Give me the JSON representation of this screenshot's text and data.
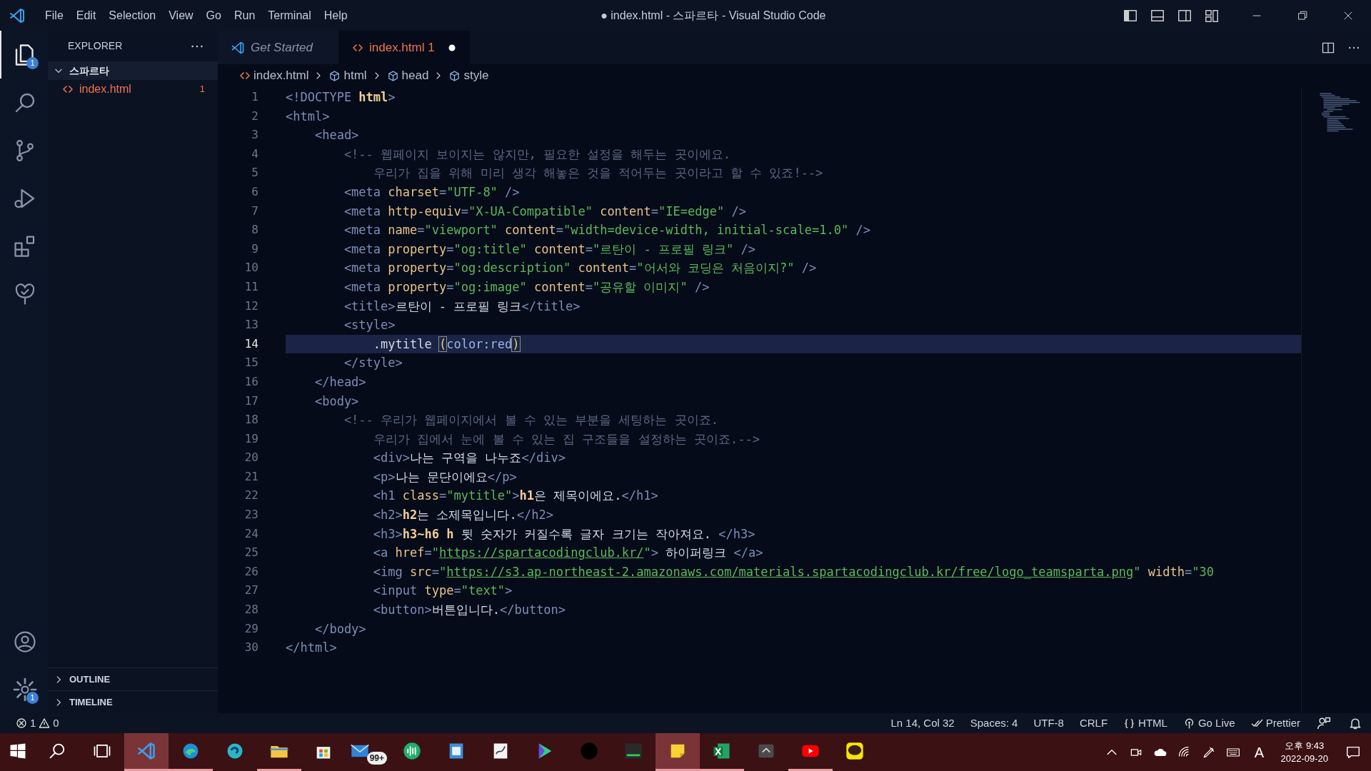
{
  "title_bar": {
    "menu": [
      "File",
      "Edit",
      "Selection",
      "View",
      "Go",
      "Run",
      "Terminal",
      "Help"
    ],
    "title": "● index.html - 스파르타 - Visual Studio Code"
  },
  "activity_bar": {
    "items": [
      {
        "kind": "files",
        "selected": true,
        "badge": "1"
      },
      {
        "kind": "search",
        "selected": false
      },
      {
        "kind": "branch",
        "selected": false
      },
      {
        "kind": "run",
        "selected": false
      },
      {
        "kind": "extensions",
        "selected": false
      },
      {
        "kind": "tree",
        "selected": false
      }
    ],
    "bottom": [
      {
        "kind": "account"
      },
      {
        "kind": "gear",
        "badge": "1"
      }
    ]
  },
  "sidebar": {
    "title": "EXPLORER",
    "folder": {
      "label": "스파르타",
      "expanded": true,
      "files": [
        {
          "label": "index.html",
          "badge": "1"
        }
      ]
    },
    "sections": [
      {
        "label": "OUTLINE",
        "expanded": false
      },
      {
        "label": "TIMELINE",
        "expanded": false
      }
    ]
  },
  "tabs": [
    {
      "label": "Get Started",
      "kind": "welcome",
      "selected": false,
      "modified": false
    },
    {
      "label": "index.html",
      "badge": "1",
      "kind": "html",
      "selected": true,
      "modified": true
    }
  ],
  "breadcrumb": [
    {
      "kind": "html",
      "label": "index.html"
    },
    {
      "kind": "cube",
      "label": "html"
    },
    {
      "kind": "cube",
      "label": "head"
    },
    {
      "kind": "cube",
      "label": "style"
    }
  ],
  "lines": [
    {
      "number": "1",
      "current": false,
      "tokens": [
        {
          "kind": "p",
          "text": "<!DOCTYPE "
        },
        {
          "kind": "b",
          "text": "html"
        },
        {
          "kind": "p",
          "text": ">"
        }
      ]
    },
    {
      "number": "2",
      "current": false,
      "tokens": [
        {
          "kind": "p",
          "text": "<html>"
        }
      ],
      "children": [
        {
          "number": "3",
          "current": false,
          "tokens": [
            {
              "kind": "p",
              "text": "<head>"
            }
          ],
          "children": [
            {
              "number": "4",
              "current": false,
              "tokens": [
                {
                  "kind": "c",
                  "text": "<!-- 웹페이지 보이지는 않지만, 필요한 설정을 해두는 곳이에요."
                }
              ],
              "children": [
                {
                  "number": "5",
                  "current": false,
                  "tokens": [
                    {
                      "kind": "c",
                      "text": "우리가 집을 위해 미리 생각 해놓은 것을 적어두는 곳이라고 할 수 있죠!-->"
                    }
                  ]
                }
              ]
            },
            {
              "number": "6",
              "current": false,
              "tokens": [
                {
                  "kind": "p",
                  "text": "<meta "
                },
                {
                  "kind": "a",
                  "text": "charset"
                },
                {
                  "kind": "p",
                  "text": "="
                },
                {
                  "kind": "s",
                  "text": "\"UTF-8\""
                },
                {
                  "kind": "p",
                  "text": " />"
                }
              ]
            },
            {
              "number": "7",
              "current": false,
              "tokens": [
                {
                  "kind": "p",
                  "text": "<meta "
                },
                {
                  "kind": "a",
                  "text": "http-equiv"
                },
                {
                  "kind": "p",
                  "text": "="
                },
                {
                  "kind": "s",
                  "text": "\"X-UA-Compatible\""
                },
                {
                  "kind": "a",
                  "text": " content"
                },
                {
                  "kind": "p",
                  "text": "="
                },
                {
                  "kind": "s",
                  "text": "\"IE=edge\""
                },
                {
                  "kind": "p",
                  "text": " />"
                }
              ]
            },
            {
              "number": "8",
              "current": false,
              "tokens": [
                {
                  "kind": "p",
                  "text": "<meta "
                },
                {
                  "kind": "a",
                  "text": "name"
                },
                {
                  "kind": "p",
                  "text": "="
                },
                {
                  "kind": "s",
                  "text": "\"viewport\""
                },
                {
                  "kind": "a",
                  "text": " content"
                },
                {
                  "kind": "p",
                  "text": "="
                },
                {
                  "kind": "s",
                  "text": "\"width=device-width, initial-scale=1.0\""
                },
                {
                  "kind": "p",
                  "text": " />"
                }
              ]
            },
            {
              "number": "9",
              "current": false,
              "tokens": [
                {
                  "kind": "p",
                  "text": "<meta "
                },
                {
                  "kind": "a",
                  "text": "property"
                },
                {
                  "kind": "p",
                  "text": "="
                },
                {
                  "kind": "s",
                  "text": "\"og:title\""
                },
                {
                  "kind": "a",
                  "text": " content"
                },
                {
                  "kind": "p",
                  "text": "="
                },
                {
                  "kind": "s",
                  "text": "\"르탄이 - 프로필 링크\""
                },
                {
                  "kind": "p",
                  "text": " />"
                }
              ]
            },
            {
              "number": "10",
              "current": false,
              "tokens": [
                {
                  "kind": "p",
                  "text": "<meta "
                },
                {
                  "kind": "a",
                  "text": "property"
                },
                {
                  "kind": "p",
                  "text": "="
                },
                {
                  "kind": "s",
                  "text": "\"og:description\""
                },
                {
                  "kind": "a",
                  "text": " content"
                },
                {
                  "kind": "p",
                  "text": "="
                },
                {
                  "kind": "s",
                  "text": "\"어서와 코딩은 처음이지?\""
                },
                {
                  "kind": "p",
                  "text": " />"
                }
              ]
            },
            {
              "number": "11",
              "current": false,
              "tokens": [
                {
                  "kind": "p",
                  "text": "<meta "
                },
                {
                  "kind": "a",
                  "text": "property"
                },
                {
                  "kind": "p",
                  "text": "="
                },
                {
                  "kind": "s",
                  "text": "\"og:image\""
                },
                {
                  "kind": "a",
                  "text": " content"
                },
                {
                  "kind": "p",
                  "text": "="
                },
                {
                  "kind": "s",
                  "text": "\"공유할 이미지\""
                },
                {
                  "kind": "p",
                  "text": " />"
                }
              ]
            },
            {
              "number": "12",
              "current": false,
              "tokens": [
                {
                  "kind": "p",
                  "text": "<title>"
                },
                {
                  "kind": "t",
                  "text": "르탄이 - 프로필 링크"
                },
                {
                  "kind": "p",
                  "text": "</title>"
                }
              ]
            },
            {
              "number": "13",
              "current": false,
              "tokens": [
                {
                  "kind": "p",
                  "text": "<style>"
                }
              ],
              "children": [
                {
                  "number": "14",
                  "current": true,
                  "tokens": [
                    {
                      "kind": "t",
                      "text": ".mytitle "
                    },
                    {
                      "kind": "m",
                      "text": "("
                    },
                    {
                      "kind": "k",
                      "text": "color:red"
                    },
                    {
                      "kind": "m",
                      "text": ")"
                    }
                  ]
                }
              ]
            },
            {
              "number": "15",
              "current": false,
              "tokens": [
                {
                  "kind": "p",
                  "text": "</style>"
                }
              ]
            }
          ]
        },
        {
          "number": "16",
          "current": false,
          "tokens": [
            {
              "kind": "p",
              "text": "</head>"
            }
          ]
        },
        {
          "number": "17",
          "current": false,
          "tokens": [
            {
              "kind": "p",
              "text": "<body>"
            }
          ],
          "children": [
            {
              "number": "18",
              "current": false,
              "tokens": [
                {
                  "kind": "c",
                  "text": "<!-- 우리가 웹페이지에서 볼 수 있는 부분을 세팅하는 곳이죠."
                }
              ],
              "children": [
                {
                  "number": "19",
                  "current": false,
                  "tokens": [
                    {
                      "kind": "c",
                      "text": "우리가 집에서 눈에 볼 수 있는 집 구조들을 설정하는 곳이죠.-->"
                    }
                  ]
                },
                {
                  "number": "20",
                  "current": false,
                  "tokens": [
                    {
                      "kind": "p",
                      "text": "<div>"
                    },
                    {
                      "kind": "t",
                      "text": "나는 구역을 나누죠"
                    },
                    {
                      "kind": "p",
                      "text": "</div>"
                    }
                  ]
                },
                {
                  "number": "21",
                  "current": false,
                  "tokens": [
                    {
                      "kind": "p",
                      "text": "<p>"
                    },
                    {
                      "kind": "t",
                      "text": "나는 문단이에요"
                    },
                    {
                      "kind": "p",
                      "text": "</p>"
                    }
                  ]
                },
                {
                  "number": "22",
                  "current": false,
                  "tokens": [
                    {
                      "kind": "p",
                      "text": "<h1 "
                    },
                    {
                      "kind": "a",
                      "text": "class"
                    },
                    {
                      "kind": "p",
                      "text": "="
                    },
                    {
                      "kind": "s",
                      "text": "\"mytitle\""
                    },
                    {
                      "kind": "p",
                      "text": ">"
                    },
                    {
                      "kind": "b",
                      "text": "h1"
                    },
                    {
                      "kind": "t",
                      "text": "은 제목이에요."
                    },
                    {
                      "kind": "p",
                      "text": "</h1>"
                    }
                  ]
                },
                {
                  "number": "23",
                  "current": false,
                  "tokens": [
                    {
                      "kind": "p",
                      "text": "<h2>"
                    },
                    {
                      "kind": "b",
                      "text": "h2"
                    },
                    {
                      "kind": "t",
                      "text": "는 소제목입니다."
                    },
                    {
                      "kind": "p",
                      "text": "</h2>"
                    }
                  ]
                },
                {
                  "number": "24",
                  "current": false,
                  "tokens": [
                    {
                      "kind": "p",
                      "text": "<h3>"
                    },
                    {
                      "kind": "b",
                      "text": "h3~h6 h"
                    },
                    {
                      "kind": "t",
                      "text": " 뒷 숫자가 커질수록 글자 크기는 작아져요. "
                    },
                    {
                      "kind": "p",
                      "text": "</h3>"
                    }
                  ]
                },
                {
                  "number": "25",
                  "current": false,
                  "tokens": [
                    {
                      "kind": "p",
                      "text": "<a "
                    },
                    {
                      "kind": "a",
                      "text": "href"
                    },
                    {
                      "kind": "p",
                      "text": "="
                    },
                    {
                      "kind": "s",
                      "text": "\""
                    },
                    {
                      "kind": "u",
                      "text": "https://spartacodingclub.kr/"
                    },
                    {
                      "kind": "s",
                      "text": "\""
                    },
                    {
                      "kind": "p",
                      "text": ">"
                    },
                    {
                      "kind": "t",
                      "text": " 하이퍼링크 "
                    },
                    {
                      "kind": "p",
                      "text": "</a>"
                    }
                  ]
                },
                {
                  "number": "26",
                  "current": false,
                  "tokens": [
                    {
                      "kind": "p",
                      "text": "<img "
                    },
                    {
                      "kind": "a",
                      "text": "src"
                    },
                    {
                      "kind": "p",
                      "text": "="
                    },
                    {
                      "kind": "s",
                      "text": "\""
                    },
                    {
                      "kind": "u",
                      "text": "https://s3.ap-northeast-2.amazonaws.com/materials.spartacodingclub.kr/free/logo_teamsparta.png"
                    },
                    {
                      "kind": "s",
                      "text": "\""
                    },
                    {
                      "kind": "a",
                      "text": " width"
                    },
                    {
                      "kind": "p",
                      "text": "="
                    },
                    {
                      "kind": "s",
                      "text": "\"30"
                    }
                  ]
                },
                {
                  "number": "27",
                  "current": false,
                  "tokens": [
                    {
                      "kind": "p",
                      "text": "<input "
                    },
                    {
                      "kind": "a",
                      "text": "type"
                    },
                    {
                      "kind": "p",
                      "text": "="
                    },
                    {
                      "kind": "s",
                      "text": "\"text\""
                    },
                    {
                      "kind": "p",
                      "text": ">"
                    }
                  ]
                },
                {
                  "number": "28",
                  "current": false,
                  "tokens": [
                    {
                      "kind": "p",
                      "text": "<button>"
                    },
                    {
                      "kind": "t",
                      "text": "버튼입니다."
                    },
                    {
                      "kind": "p",
                      "text": "</button>"
                    }
                  ]
                }
              ]
            }
          ]
        },
        {
          "number": "29",
          "current": false,
          "tokens": [
            {
              "kind": "p",
              "text": "</body>"
            }
          ]
        }
      ]
    },
    {
      "number": "30",
      "current": false,
      "tokens": [
        {
          "kind": "p",
          "text": "</html>"
        }
      ]
    }
  ],
  "status_bar": {
    "errors": "1",
    "warnings": "0",
    "items": [
      {
        "kind": "text",
        "label": "Ln 14, Col 32"
      },
      {
        "kind": "text",
        "label": "Spaces: 4"
      },
      {
        "kind": "text",
        "label": "UTF-8"
      },
      {
        "kind": "text",
        "label": "CRLF"
      },
      {
        "kind": "braces",
        "label": "HTML"
      },
      {
        "kind": "broadcast",
        "label": "Go Live"
      },
      {
        "kind": "checks",
        "label": "Prettier"
      },
      {
        "kind": "feedback"
      },
      {
        "kind": "bell"
      }
    ]
  },
  "taskbar": {
    "apps": [
      {
        "kind": "windows",
        "selected": false,
        "running": false
      },
      {
        "kind": "search",
        "selected": false,
        "running": false
      },
      {
        "kind": "taskview",
        "selected": false,
        "running": false
      },
      {
        "kind": "vscode",
        "selected": true,
        "running": true
      },
      {
        "kind": "edge",
        "selected": false,
        "running": true
      },
      {
        "kind": "swirl",
        "selected": false,
        "running": false
      },
      {
        "kind": "folder",
        "selected": false,
        "running": true
      },
      {
        "kind": "store",
        "selected": false,
        "running": false
      },
      {
        "kind": "mail",
        "selected": false,
        "running": false,
        "badge": "99+"
      },
      {
        "kind": "wave",
        "selected": false,
        "running": false
      },
      {
        "kind": "doc",
        "selected": false,
        "running": false
      },
      {
        "kind": "ink",
        "selected": false,
        "running": false
      },
      {
        "kind": "play",
        "selected": false,
        "running": false
      },
      {
        "kind": "circle",
        "selected": false,
        "running": false
      },
      {
        "kind": "terminal",
        "selected": false,
        "running": false
      },
      {
        "kind": "note",
        "selected": true,
        "running": true
      },
      {
        "kind": "excel",
        "selected": false,
        "running": true
      },
      {
        "kind": "grayapp",
        "selected": false,
        "running": false
      },
      {
        "kind": "youtube",
        "selected": false,
        "running": true
      },
      {
        "kind": "talk",
        "selected": false,
        "running": false
      }
    ],
    "tray": [
      {
        "kind": "chevron"
      },
      {
        "kind": "camera"
      },
      {
        "kind": "cloud"
      },
      {
        "kind": "wifi"
      },
      {
        "kind": "pen"
      },
      {
        "kind": "keyboard"
      },
      {
        "kind": "ime",
        "label": "A"
      }
    ],
    "clock": {
      "time": "오후 9:43",
      "date": "2022-09-20"
    }
  }
}
